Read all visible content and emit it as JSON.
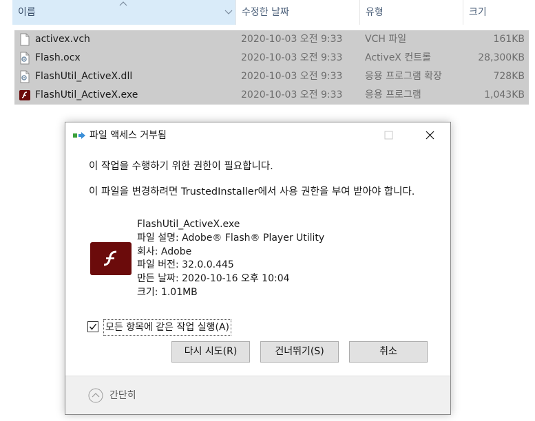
{
  "columns": {
    "name": "이름",
    "date": "수정한 날짜",
    "type": "유형",
    "size": "크기"
  },
  "files": [
    {
      "name": "activex.vch",
      "date": "2020-10-03 오전 9:33",
      "type": "VCH 파일",
      "size": "161KB",
      "icon": "document-icon"
    },
    {
      "name": "Flash.ocx",
      "date": "2020-10-03 오전 9:33",
      "type": "ActiveX 컨트롤",
      "size": "28,300KB",
      "icon": "gear-file-icon"
    },
    {
      "name": "FlashUtil_ActiveX.dll",
      "date": "2020-10-03 오전 9:33",
      "type": "응용 프로그램 확장",
      "size": "728KB",
      "icon": "gear-file-icon"
    },
    {
      "name": "FlashUtil_ActiveX.exe",
      "date": "2020-10-03 오전 9:33",
      "type": "응용 프로그램",
      "size": "1,043KB",
      "icon": "flash-app-icon"
    }
  ],
  "dialog": {
    "title": "파일 액세스 거부됨",
    "message1": "이 작업을 수행하기 위한 권한이 필요합니다.",
    "message2": "이 파일을 변경하려면 TrustedInstaller에서 사용 권한을 부여 받아야 합니다.",
    "file_info": {
      "filename": "FlashUtil_ActiveX.exe",
      "description": "파일 설명: Adobe® Flash® Player Utility",
      "company": "회사: Adobe",
      "version": "파일 버전: 32.0.0.445",
      "created": "만든 날짜: 2020-10-16 오후 10:04",
      "size": "크기: 1.01MB"
    },
    "apply_all_label": "모든 항목에 같은 작업 실행(A)",
    "apply_all_checked": true,
    "buttons": {
      "retry": "다시 시도(R)",
      "skip": "건너뛰기(S)",
      "cancel": "취소"
    },
    "fewer_details": "간단히"
  },
  "colors": {
    "header_selected": "#d9ebf9",
    "row_selected": "#cccccc",
    "flash_red": "#6b0b0b",
    "footer_bg": "#f0f0f0"
  }
}
